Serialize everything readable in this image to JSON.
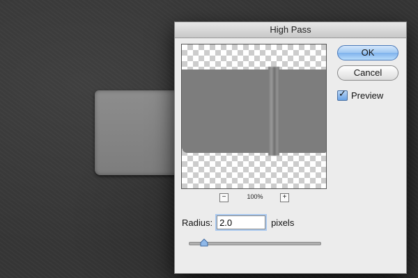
{
  "dialog": {
    "title": "High Pass",
    "ok_label": "OK",
    "cancel_label": "Cancel",
    "preview_label": "Preview",
    "preview_checked": true,
    "zoom": {
      "minus": "−",
      "level": "100%",
      "plus": "+"
    },
    "radius": {
      "label": "Radius:",
      "value": "2.0",
      "unit": "pixels",
      "slider_fraction": 0.11
    }
  },
  "colors": {
    "default_button": "#9fc7f2",
    "dialog_bg": "#ececec",
    "canvas_bg": "#363636"
  }
}
